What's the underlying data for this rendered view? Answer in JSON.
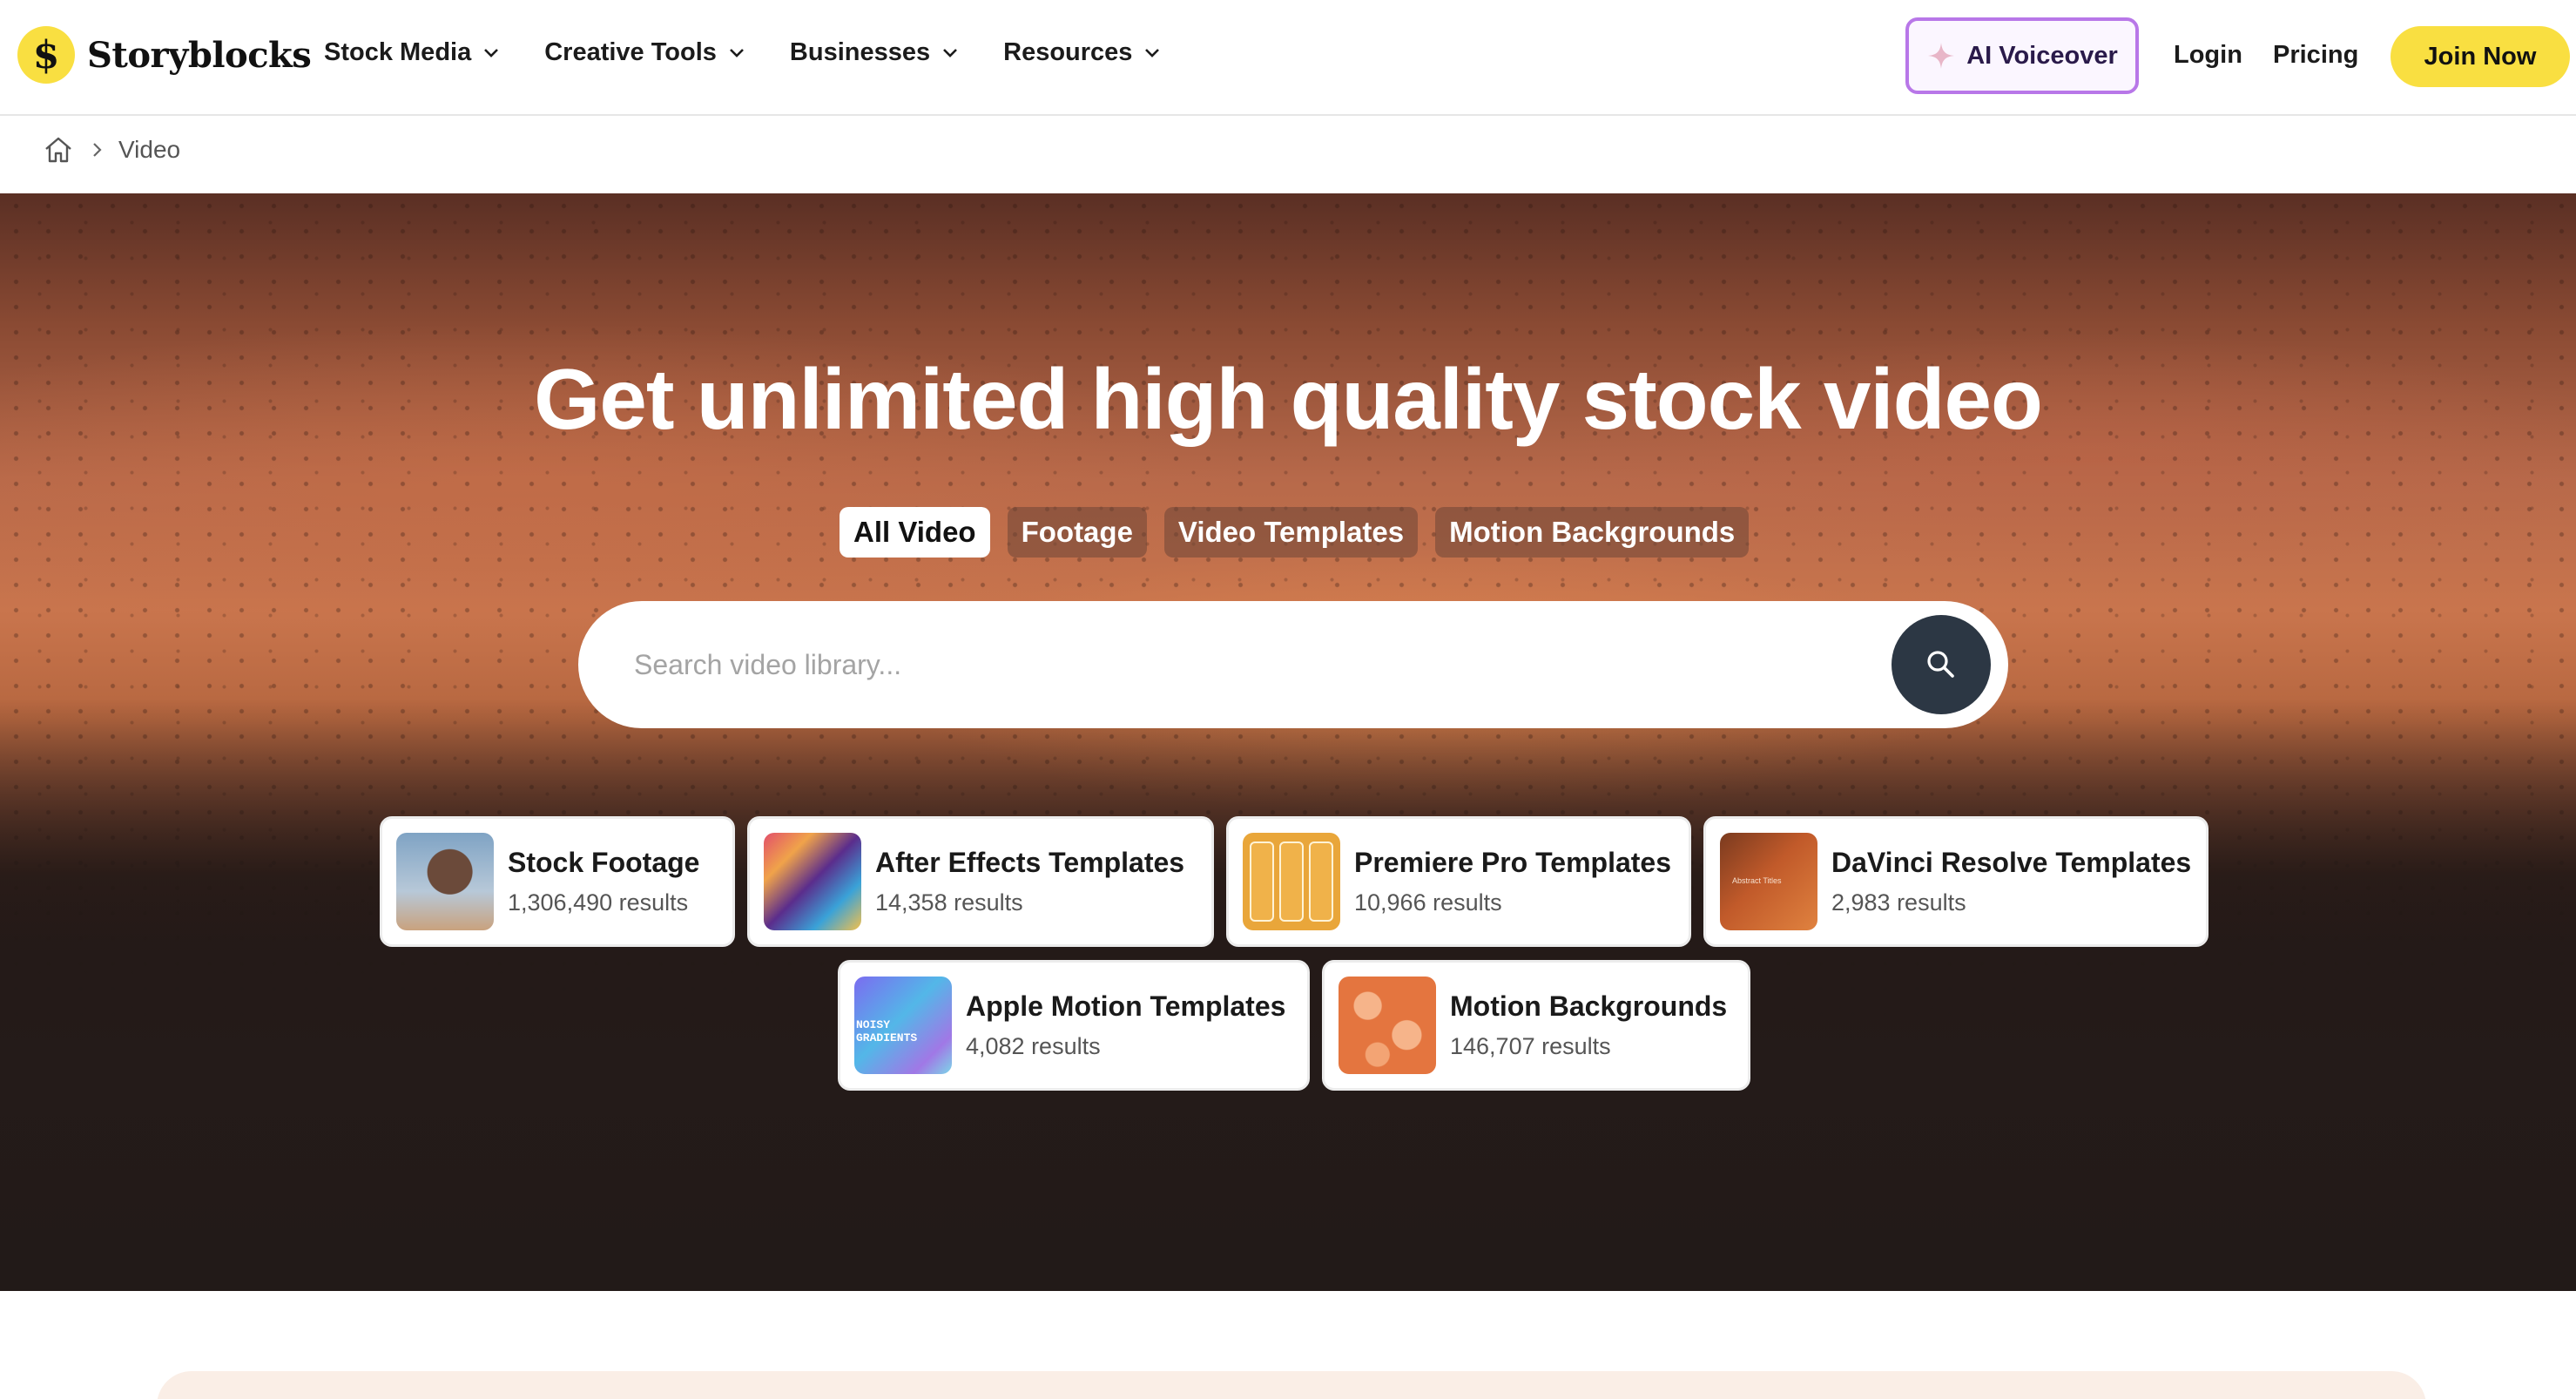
{
  "header": {
    "logo_text": "Storyblocks",
    "nav": [
      {
        "label": "Stock Media"
      },
      {
        "label": "Creative Tools"
      },
      {
        "label": "Businesses"
      },
      {
        "label": "Resources"
      }
    ],
    "ai_voiceover": "AI Voiceover",
    "login": "Login",
    "pricing": "Pricing",
    "join": "Join Now"
  },
  "breadcrumb": {
    "current": "Video"
  },
  "hero": {
    "title": "Get unlimited high quality stock video",
    "tabs": [
      {
        "label": "All Video",
        "active": true
      },
      {
        "label": "Footage",
        "active": false
      },
      {
        "label": "Video Templates",
        "active": false
      },
      {
        "label": "Motion Backgrounds",
        "active": false
      }
    ],
    "search": {
      "placeholder": "Search video library...",
      "value": ""
    },
    "categories": [
      {
        "title": "Stock Footage",
        "results": "1,306,490 results"
      },
      {
        "title": "After Effects Templates",
        "results": "14,358 results"
      },
      {
        "title": "Premiere Pro Templates",
        "results": "10,966 results"
      },
      {
        "title": "DaVinci Resolve Templates",
        "results": "2,983 results",
        "thumb_text": "Abstract Titles"
      },
      {
        "title": "Apple Motion Templates",
        "results": "4,082 results",
        "thumb_text": "NOISY GRADIENTS"
      },
      {
        "title": "Motion Backgrounds",
        "results": "146,707 results"
      }
    ]
  },
  "colors": {
    "brand_yellow": "#f9df41",
    "ai_border": "#b877e8",
    "search_button": "#2c3744",
    "bottom_band": "#faeee6"
  },
  "icons": {
    "logo": "storyblocks-s-logo-icon",
    "chevron": "chevron-down-icon",
    "sparkle": "sparkle-icon",
    "home": "home-icon",
    "breadcrumb_sep": "chevron-right-icon",
    "search": "search-icon"
  }
}
